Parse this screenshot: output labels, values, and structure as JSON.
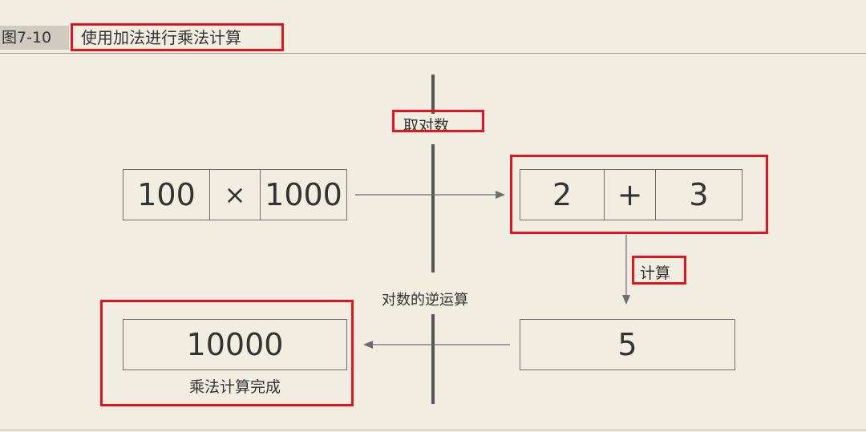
{
  "figure": {
    "label": "图7-10",
    "title": "使用加法进行乘法计算"
  },
  "diagram": {
    "left_expression": {
      "a": "100",
      "operator": "×",
      "b": "1000"
    },
    "log_label": "取对数",
    "right_expression": {
      "a": "2",
      "operator": "+",
      "b": "3"
    },
    "compute_label": "计算",
    "sum_result": "5",
    "inverse_label": "对数的逆运算",
    "final_result": "10000",
    "final_caption": "乘法计算完成"
  },
  "colors": {
    "background": "#f1ede1",
    "highlight": "#e3141d",
    "line": "#555555"
  }
}
